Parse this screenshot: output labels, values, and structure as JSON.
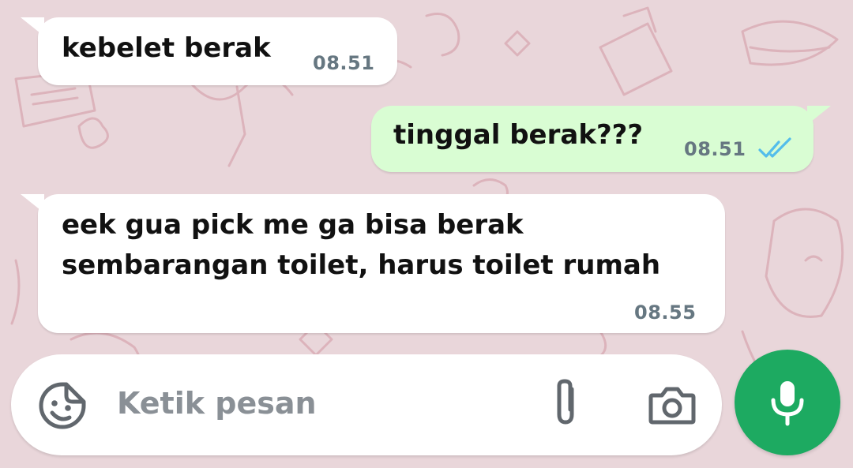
{
  "colors": {
    "wallpaper": "#e9d6da",
    "incoming_bubble": "#ffffff",
    "outgoing_bubble": "#d9fdd3",
    "timestamp": "#667781",
    "read_ticks": "#53bdeb",
    "mic_button": "#1daa61"
  },
  "messages": [
    {
      "direction": "incoming",
      "lines": [
        "kebelet berak"
      ],
      "time": "08.51"
    },
    {
      "direction": "outgoing",
      "lines": [
        "tinggal berak???"
      ],
      "time": "08.51",
      "status": "read"
    },
    {
      "direction": "incoming",
      "lines": [
        "eek gua pick me ga bisa berak",
        "sembarangan toilet, harus toilet rumah"
      ],
      "time": "08.55"
    }
  ],
  "composer": {
    "placeholder": "Ketik pesan",
    "icons": [
      "sticker-icon",
      "paperclip-icon",
      "camera-icon",
      "microphone-icon"
    ]
  }
}
